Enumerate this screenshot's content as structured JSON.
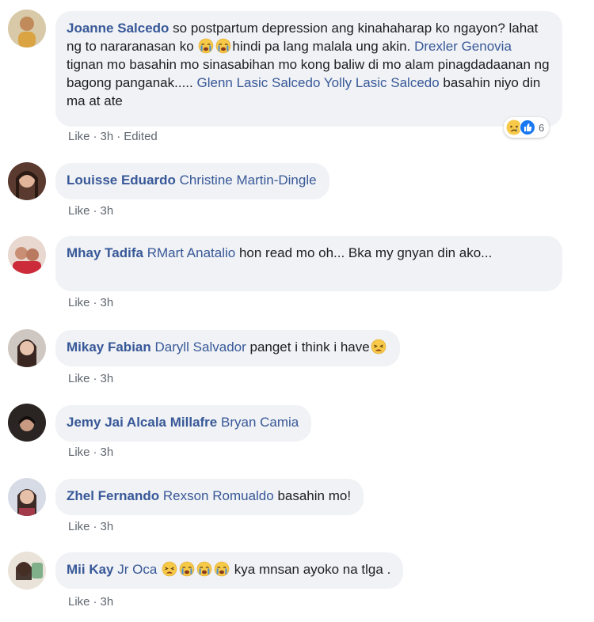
{
  "comments": [
    {
      "author": "Joanne Salcedo",
      "parts": [
        {
          "t": "text",
          "v": "so postpartum depression ang kinahaharap ko ngayon? lahat ng to nararanasan ko "
        },
        {
          "t": "emoji",
          "v": "crying-face"
        },
        {
          "t": "emoji",
          "v": "crying-face"
        },
        {
          "t": "text",
          "v": "hindi pa lang malala ung akin. "
        },
        {
          "t": "mention",
          "v": "Drexler Genovia"
        },
        {
          "t": "text",
          "v": " tignan mo basahin mo sinasabihan mo kong baliw di mo alam pinagdadaanan ng bagong panganak..... "
        },
        {
          "t": "mention",
          "v": "Glenn Lasic Salcedo"
        },
        {
          "t": "text",
          "v": " "
        },
        {
          "t": "mention",
          "v": "Yolly Lasic Salcedo"
        },
        {
          "t": "text",
          "v": " basahin niyo din ma at ate"
        }
      ],
      "like": "Like",
      "time": "3h",
      "edited": "Edited",
      "reaction_count": "6"
    },
    {
      "author": "Louisse Eduardo",
      "parts": [
        {
          "t": "mention",
          "v": "Christine Martin-Dingle"
        }
      ],
      "like": "Like",
      "time": "3h"
    },
    {
      "author": "Mhay Tadifa",
      "parts": [
        {
          "t": "mention",
          "v": "RMart Anatalio"
        },
        {
          "t": "text",
          "v": " hon read mo oh... Bka my gnyan din ako..."
        }
      ],
      "like": "Like",
      "time": "3h"
    },
    {
      "author": "Mikay Fabian",
      "parts": [
        {
          "t": "mention",
          "v": "Daryll Salvador"
        },
        {
          "t": "text",
          "v": " panget i think i have"
        },
        {
          "t": "emoji",
          "v": "weary-face"
        }
      ],
      "like": "Like",
      "time": "3h"
    },
    {
      "author": "Jemy Jai Alcala Millafre",
      "parts": [
        {
          "t": "mention",
          "v": "Bryan Camia"
        }
      ],
      "like": "Like",
      "time": "3h"
    },
    {
      "author": "Zhel Fernando",
      "parts": [
        {
          "t": "mention",
          "v": "Rexson Romualdo"
        },
        {
          "t": "text",
          "v": " basahin mo!"
        }
      ],
      "like": "Like",
      "time": "3h"
    },
    {
      "author": "Mii Kay",
      "parts": [
        {
          "t": "mention",
          "v": "Jr Oca"
        },
        {
          "t": "text",
          "v": " "
        },
        {
          "t": "emoji",
          "v": "weary-face"
        },
        {
          "t": "emoji",
          "v": "crying-face"
        },
        {
          "t": "emoji",
          "v": "crying-face"
        },
        {
          "t": "emoji",
          "v": "crying-face"
        },
        {
          "t": "text",
          "v": " kya mnsan ayoko na tlga ."
        }
      ],
      "like": "Like",
      "time": "3h"
    }
  ],
  "colors": {
    "link": "#385898",
    "bubble": "#f0f2f5",
    "meta": "#606770",
    "emoji_yellow": "#f7c948",
    "tears_blue": "#4a90d9"
  },
  "reaction_icons": [
    "sad-reaction-icon",
    "like-reaction-icon"
  ]
}
